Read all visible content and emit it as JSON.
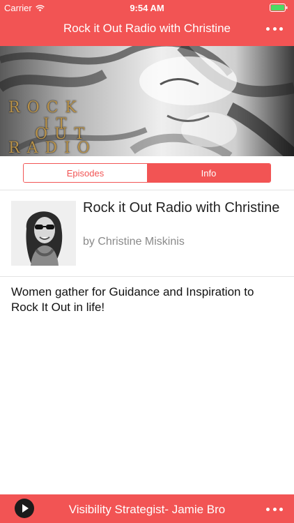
{
  "status_bar": {
    "carrier": "Carrier",
    "time": "9:54 AM",
    "wifi_icon": "wifi-icon",
    "battery_icon": "battery-icon"
  },
  "nav": {
    "title": "Rock it Out Radio with Christine",
    "more_icon": "more-icon"
  },
  "hero": {
    "lines": [
      "ROCK",
      "IT",
      "OUT",
      "RADIO"
    ]
  },
  "segments": {
    "episodes_label": "Episodes",
    "info_label": "Info",
    "selected": "Info"
  },
  "podcast": {
    "title": "Rock it Out Radio with Christine",
    "author": "by Christine Miskinis"
  },
  "description": "Women gather for Guidance and Inspiration to Rock It Out in life!",
  "player": {
    "play_icon": "play-icon",
    "now_playing": "Visibility Strategist- Jamie Bro",
    "more_icon": "more-icon"
  },
  "colors": {
    "accent": "#f25454",
    "hero_text": "#b8924a"
  }
}
